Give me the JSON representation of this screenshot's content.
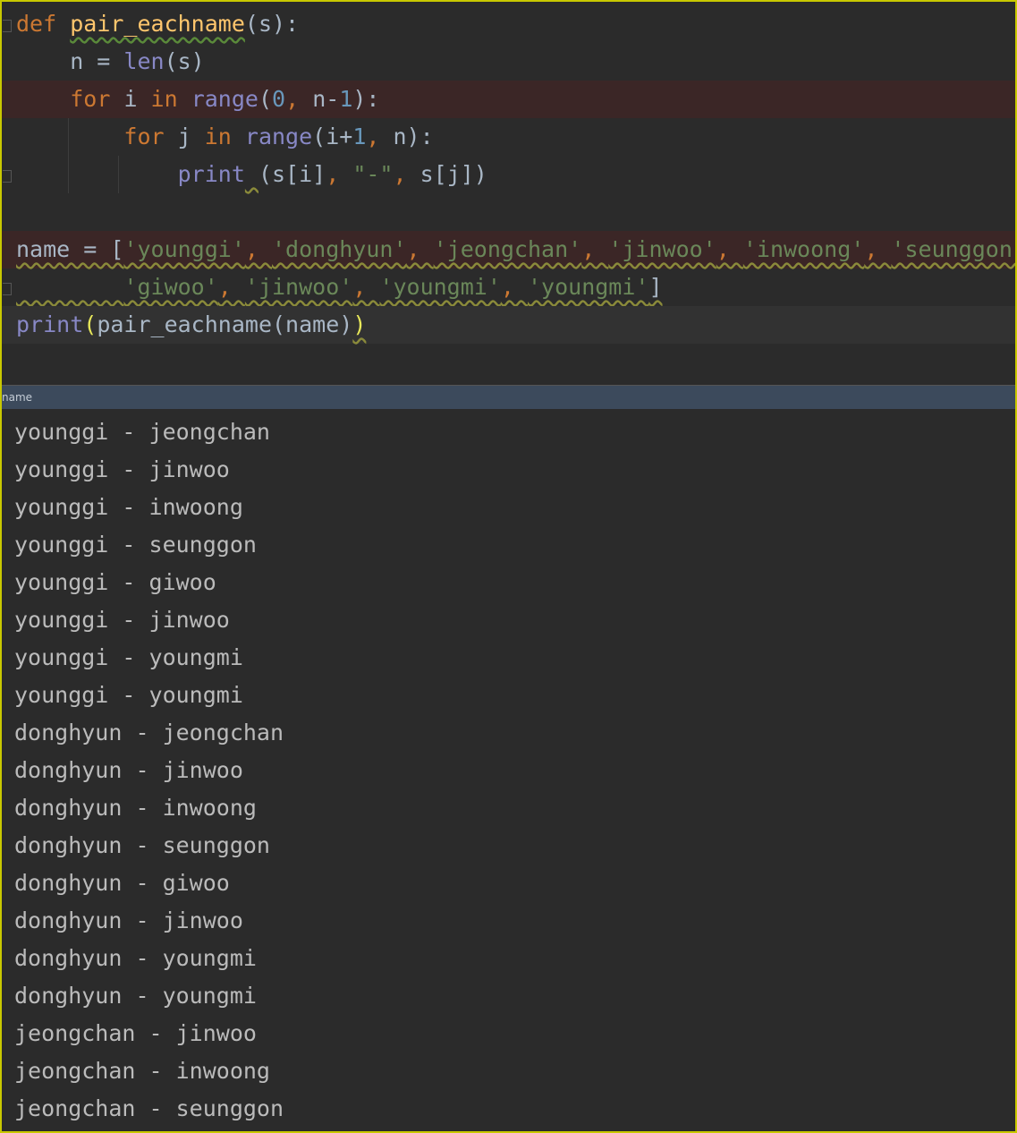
{
  "editor": {
    "lines": [
      {
        "tokens": [
          [
            "kw",
            "def "
          ],
          [
            "fn wavy-green",
            "pair_eachname"
          ],
          [
            "",
            "(s):"
          ]
        ]
      },
      {
        "tokens": [
          [
            "",
            "    n = "
          ],
          [
            "bi",
            "len"
          ],
          [
            "",
            "(s)"
          ]
        ]
      },
      {
        "tokens": [
          [
            "",
            "    "
          ],
          [
            "kw",
            "for "
          ],
          [
            "",
            "i "
          ],
          [
            "kw",
            "in "
          ],
          [
            "bi",
            "range"
          ],
          [
            "",
            "("
          ],
          [
            "num",
            "0"
          ],
          [
            "kw",
            ", "
          ],
          [
            "",
            "n-"
          ],
          [
            "num",
            "1"
          ],
          [
            "",
            "):"
          ]
        ]
      },
      {
        "tokens": [
          [
            "",
            "        "
          ],
          [
            "kw",
            "for "
          ],
          [
            "",
            "j "
          ],
          [
            "kw",
            "in "
          ],
          [
            "bi",
            "range"
          ],
          [
            "",
            "(i+"
          ],
          [
            "num",
            "1"
          ],
          [
            "kw",
            ", "
          ],
          [
            "",
            "n):"
          ]
        ]
      },
      {
        "tokens": [
          [
            "",
            "            "
          ],
          [
            "bi",
            "print"
          ],
          [
            "wavy",
            " "
          ],
          [
            "",
            "(s[i]"
          ],
          [
            "kw",
            ", "
          ],
          [
            "str",
            "\"-\""
          ],
          [
            "kw",
            ", "
          ],
          [
            "",
            "s[j])"
          ]
        ]
      },
      {
        "tokens": []
      },
      {
        "tokens": [
          [
            "wavy",
            "name = ["
          ],
          [
            "str wavy",
            "'younggi'"
          ],
          [
            "kw wavy",
            ", "
          ],
          [
            "str wavy",
            "'donghyun'"
          ],
          [
            "kw wavy",
            ", "
          ],
          [
            "str wavy",
            "'jeongchan'"
          ],
          [
            "kw wavy",
            ", "
          ],
          [
            "str wavy",
            "'jinwoo'"
          ],
          [
            "kw wavy",
            ", "
          ],
          [
            "str wavy",
            "'inwoong'"
          ],
          [
            "kw wavy",
            ", "
          ],
          [
            "str wavy",
            "'seunggon'"
          ],
          [
            "kw wavy",
            ","
          ]
        ]
      },
      {
        "tokens": [
          [
            "wavy",
            "        "
          ],
          [
            "str wavy",
            "'giwoo'"
          ],
          [
            "kw wavy",
            ", "
          ],
          [
            "str wavy",
            "'jinwoo'"
          ],
          [
            "kw wavy",
            ", "
          ],
          [
            "str wavy",
            "'youngmi'"
          ],
          [
            "kw wavy",
            ", "
          ],
          [
            "str wavy",
            "'youngmi'"
          ],
          [
            "wavy",
            "]"
          ]
        ]
      },
      {
        "tokens": [
          [
            "bi",
            "print"
          ],
          [
            "paren",
            "("
          ],
          [
            "",
            "pair_eachname(name)"
          ],
          [
            "paren wavy",
            ")"
          ]
        ]
      }
    ]
  },
  "console": {
    "tab_label": "name",
    "output": [
      "younggi - jeongchan",
      "younggi - jinwoo",
      "younggi - inwoong",
      "younggi - seunggon",
      "younggi - giwoo",
      "younggi - jinwoo",
      "younggi - youngmi",
      "younggi - youngmi",
      "donghyun - jeongchan",
      "donghyun - jinwoo",
      "donghyun - inwoong",
      "donghyun - seunggon",
      "donghyun - giwoo",
      "donghyun - jinwoo",
      "donghyun - youngmi",
      "donghyun - youngmi",
      "jeongchan - jinwoo",
      "jeongchan - inwoong",
      "jeongchan - seunggon"
    ]
  }
}
